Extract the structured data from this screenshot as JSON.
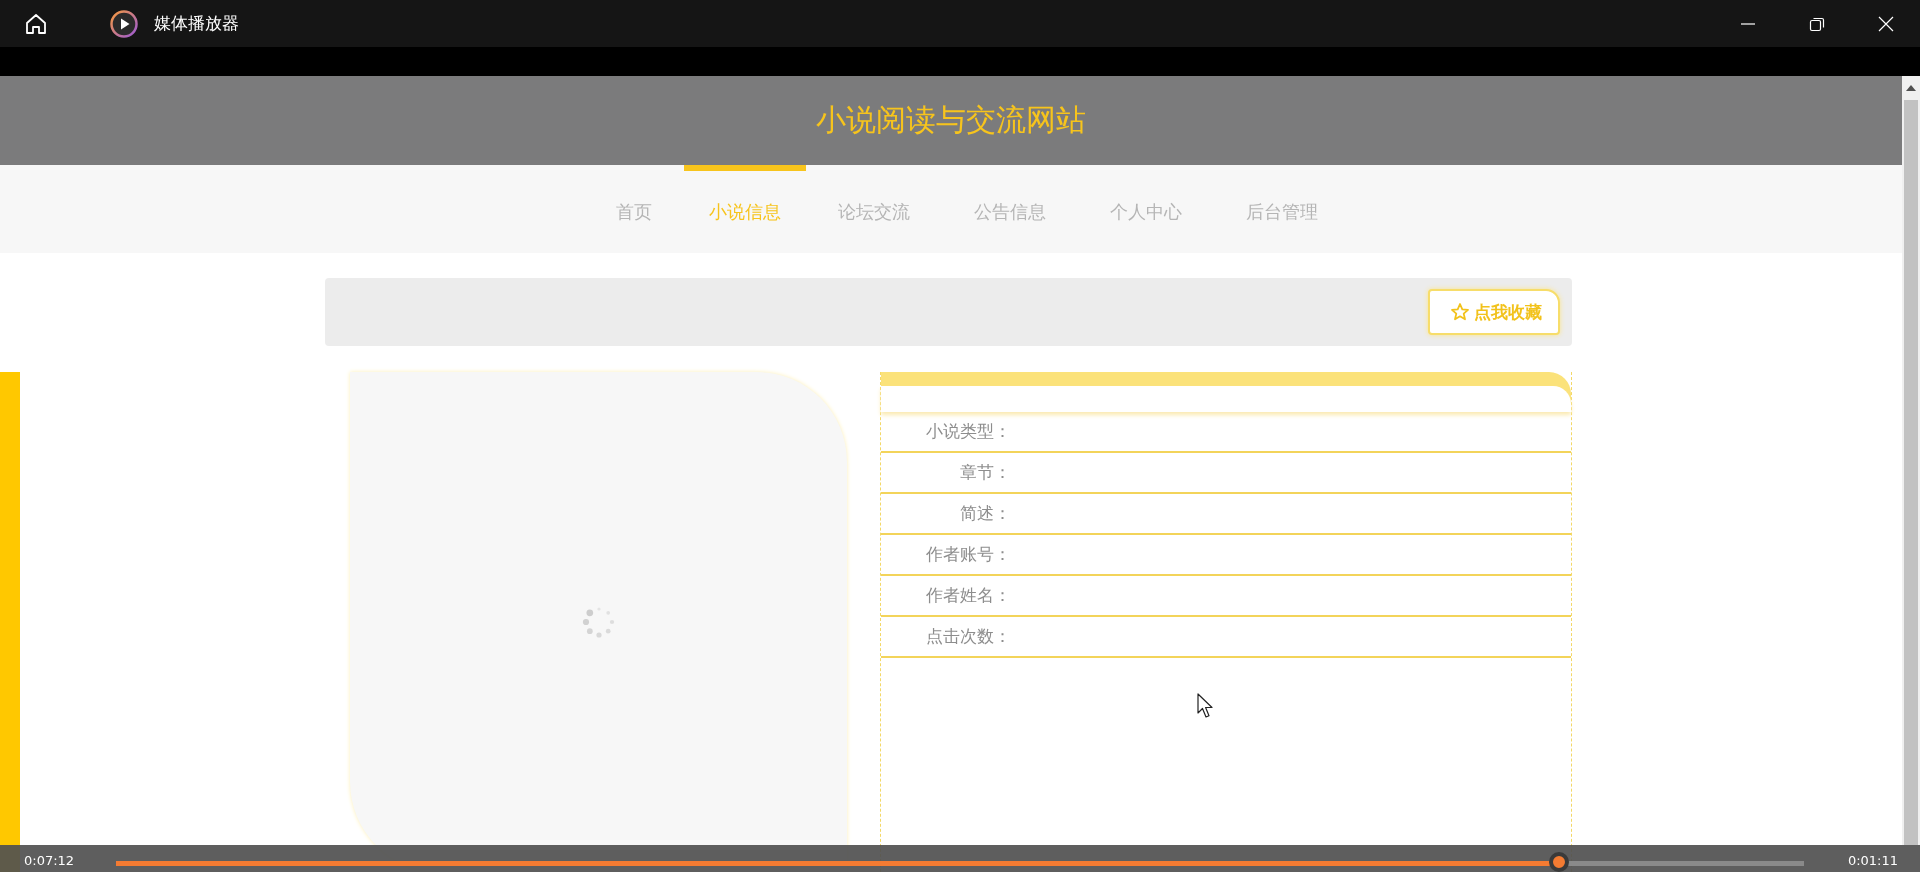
{
  "window": {
    "title": "媒体播放器"
  },
  "site": {
    "title": "小说阅读与交流网站",
    "nav": [
      {
        "label": "首页",
        "selected": false
      },
      {
        "label": "小说信息",
        "selected": true
      },
      {
        "label": "论坛交流",
        "selected": false
      },
      {
        "label": "公告信息",
        "selected": false
      },
      {
        "label": "个人中心",
        "selected": false
      },
      {
        "label": "后台管理",
        "selected": false
      }
    ]
  },
  "favorite_button": {
    "label": "点我收藏"
  },
  "details": {
    "fields": [
      {
        "label": "小说类型："
      },
      {
        "label": "章节："
      },
      {
        "label": "简述："
      },
      {
        "label": "作者账号："
      },
      {
        "label": "作者姓名："
      },
      {
        "label": "点击次数："
      }
    ]
  },
  "player": {
    "elapsed": "0:07:12",
    "remaining": "0:01:11",
    "level": 0.855
  }
}
